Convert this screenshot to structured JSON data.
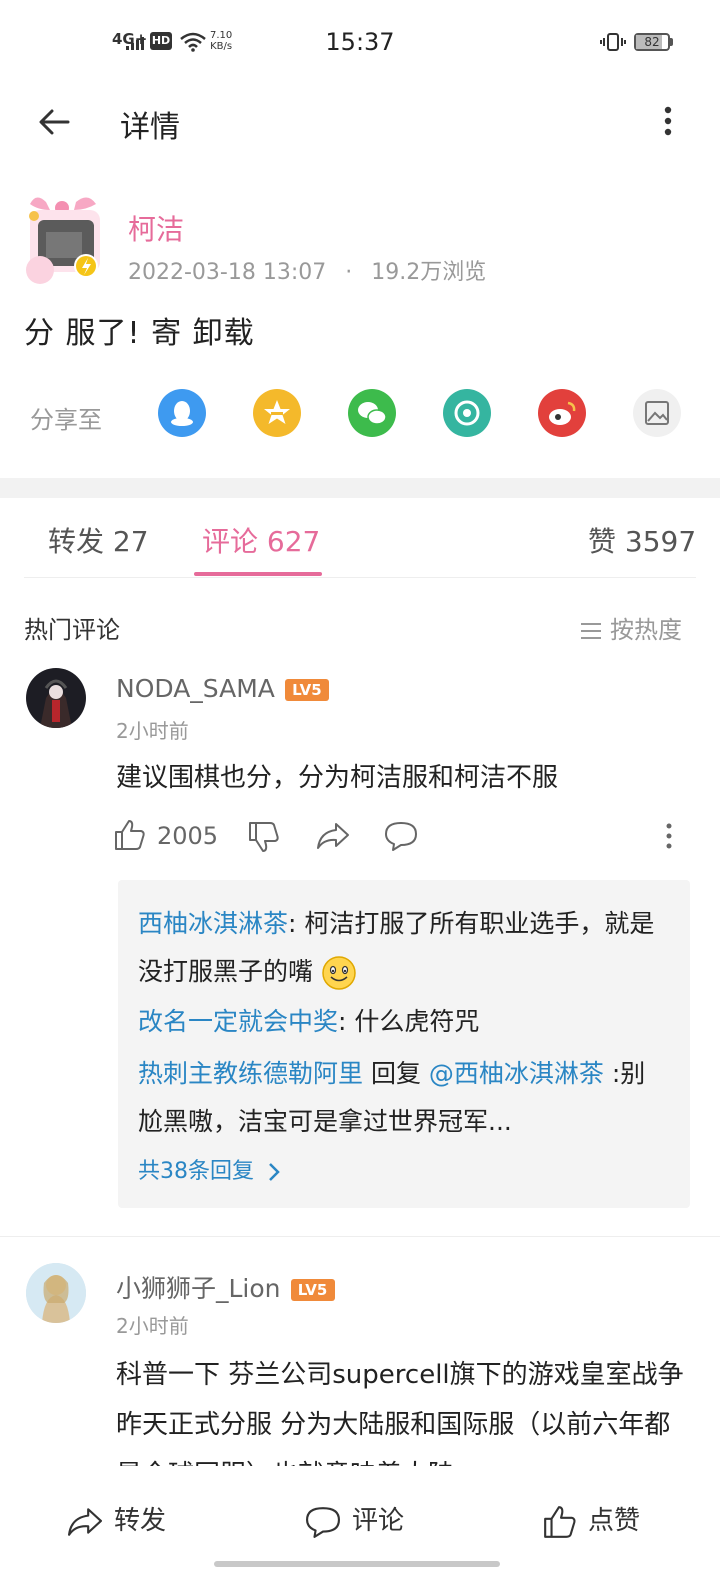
{
  "status_bar": {
    "time": "15:37",
    "network": "4G+",
    "hd": "HD",
    "speed_value": "7.10",
    "speed_unit": "KB/s",
    "battery": "82",
    "battery_level": 0.82
  },
  "header": {
    "title": "详情"
  },
  "post": {
    "author": "柯洁",
    "date": "2022-03-18 13:07",
    "dot": "·",
    "views": "19.2万浏览",
    "content": "分 服了!  寄 卸载",
    "share_label": "分享至",
    "share_targets": [
      "qq-icon",
      "qzone-icon",
      "wechat-icon",
      "moments-icon",
      "weibo-icon",
      "image-icon"
    ]
  },
  "tabs": {
    "repost": "转发 27",
    "comments": "评论 627",
    "likes": "赞 3597"
  },
  "comments_section": {
    "title": "热门评论",
    "sort_label": "按热度"
  },
  "comments": [
    {
      "name": "NODA_SAMA",
      "level": "LV5",
      "time": "2小时前",
      "text": "建议围棋也分，分为柯洁服和柯洁不服",
      "likes": "2005",
      "replies": [
        {
          "nick": "西柚冰淇淋茶",
          "text": ": 柯洁打服了所有职业选手，就是没打服黑子的嘴"
        },
        {
          "nick": "改名一定就会中奖",
          "text": ": 什么虎符咒"
        },
        {
          "nick": "热刺主教练德勒阿里",
          "mid": " 回复 ",
          "at": "@西柚冰淇淋茶",
          "text": " :别尬黑嗷，洁宝可是拿过世界冠军..."
        }
      ],
      "reply_more": "共38条回复"
    },
    {
      "name": "小狮狮子_Lion",
      "level": "LV5",
      "time": "2小时前",
      "text": "科普一下 芬兰公司supercell旗下的游戏皇室战争昨天正式分服 分为大陆服和国际服（以前六年都是全球同服）也就意味着大陆"
    }
  ],
  "bottom_bar": {
    "repost": "转发",
    "comment": "评论",
    "like": "点赞"
  },
  "colors": {
    "accent_pink": "#e66b9a",
    "link_blue": "#2a86c4",
    "level_orange": "#f08a3a"
  }
}
